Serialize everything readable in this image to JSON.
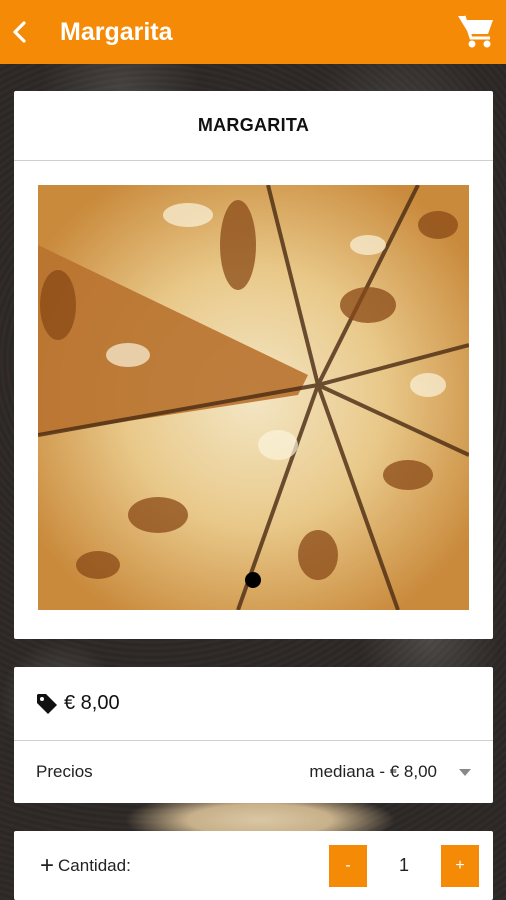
{
  "header": {
    "title": "Margarita"
  },
  "product": {
    "name": "MARGARITA"
  },
  "price": {
    "value": "€ 8,00"
  },
  "prices_select": {
    "label": "Precios",
    "selected": "mediana - € 8,00"
  },
  "quantity": {
    "label": "Cantidad:",
    "plus_sign": "+",
    "decrement": "-",
    "increment": "+",
    "value": "1"
  },
  "colors": {
    "accent": "#f58a07"
  },
  "icons": {
    "back": "chevron-left-icon",
    "cart": "cart-icon",
    "price": "tag-icon"
  }
}
